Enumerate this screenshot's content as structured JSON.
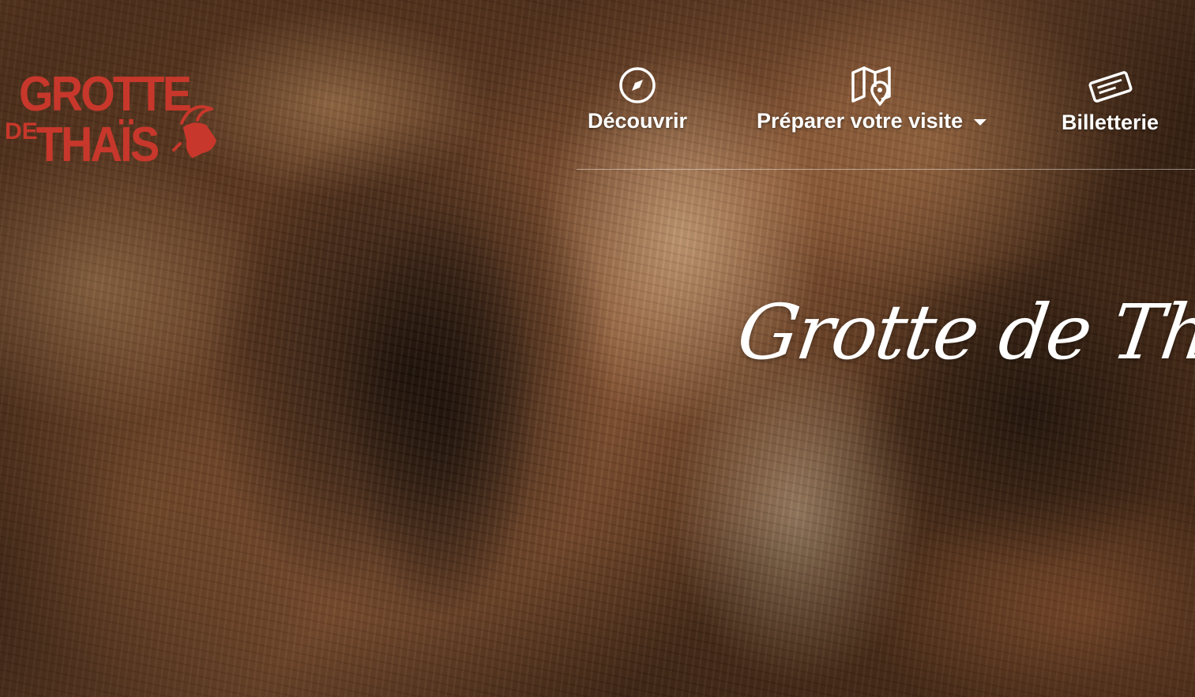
{
  "brand": {
    "logo_line1": "GROTTE",
    "logo_line2_small": "DE",
    "logo_line2": "THAÏS",
    "logo_color": "#c8372b"
  },
  "nav": {
    "items": [
      {
        "label": "Découvrir",
        "icon": "compass-icon"
      },
      {
        "label": "Préparer votre visite",
        "icon": "map-pin-icon",
        "has_dropdown": true
      },
      {
        "label": "Billetterie",
        "icon": "ticket-icon"
      }
    ]
  },
  "hero": {
    "title": "Grotte de Thaïs",
    "background": "cave-photo"
  }
}
